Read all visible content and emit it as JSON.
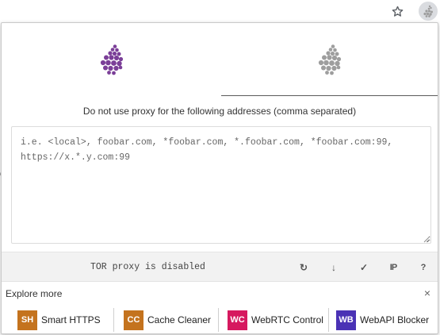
{
  "toolbar": {
    "star_icon": "star-outline-icon",
    "extension_icon": "tor-onion-extension-icon"
  },
  "tabs": [
    {
      "icon": "onion-dots-icon",
      "color": "#7b3f98",
      "active": true
    },
    {
      "icon": "onion-dots-icon",
      "color": "#9e9e9e",
      "active": false
    }
  ],
  "bypass": {
    "description": "Do not use proxy for the following addresses (comma separated)",
    "placeholder": "i.e. <local>, foobar.com, *foobar.com, *.foobar.com, *foobar.com:99, https://x.*.y.com:99",
    "value": ""
  },
  "status": {
    "text": "TOR proxy is disabled",
    "actions": [
      {
        "name": "reload",
        "icon": "reload-icon",
        "glyph": "↻"
      },
      {
        "name": "download",
        "icon": "arrow-down-icon",
        "glyph": "↓"
      },
      {
        "name": "check",
        "icon": "check-icon",
        "glyph": "✓"
      },
      {
        "name": "ip",
        "icon": "ip-icon",
        "glyph": "IP"
      },
      {
        "name": "help",
        "icon": "help-icon",
        "glyph": "?"
      }
    ]
  },
  "explore": {
    "title": "Explore more",
    "close_glyph": "×",
    "items": [
      {
        "badge": "SH",
        "label": "Smart HTTPS",
        "color": "#c4731e"
      },
      {
        "badge": "CC",
        "label": "Cache Cleaner",
        "color": "#c4731e"
      },
      {
        "badge": "WC",
        "label": "WebRTC Control",
        "color": "#d6195f"
      },
      {
        "badge": "WB",
        "label": "WebAPI Blocker",
        "color": "#4a32b5"
      }
    ]
  },
  "colors": {
    "accent_purple": "#7b3f98",
    "inactive_gray": "#9e9e9e"
  }
}
